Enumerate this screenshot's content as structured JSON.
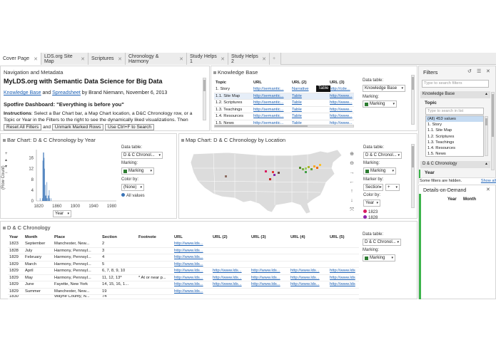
{
  "tabs": [
    {
      "label": "Cover Page",
      "active": true,
      "close": "✕"
    },
    {
      "label": "LDS.org Site Map",
      "close": "✕"
    },
    {
      "label": "Scriptures",
      "close": "✕"
    },
    {
      "label": "Chronology & Harmony",
      "close": "✕"
    },
    {
      "label": "Study Helps 1",
      "close": "✕"
    },
    {
      "label": "Study Helps 2",
      "close": "✕"
    }
  ],
  "add_tab": "+",
  "nav": {
    "title": "Navigation and Metadata",
    "heading": "MyLDS.org with Semantic Data Science for Big Data",
    "link1": "Knowledge Base",
    "and": "and",
    "link2": "Spreadsheet",
    "byline": "by Brand Niemann, November 6, 2013",
    "dashboard": "Spotfire Dashboard: \"Everything is before you\"",
    "instr_label": "Instructions",
    "instr_text1": ": Select a Bar Chart bar, a Map Chart location, a D&C Chronology row, or a",
    "instr_text2": "Topic or Year in the Filters to the right to see the dynamically liked visualizations. Then",
    "btn_reset": "Reset All Filters",
    "btn_and": "and",
    "btn_unmark": "Unmark Marked Rows",
    "btn_ctrl": "Use Ctrl+F to Search"
  },
  "kb": {
    "title": "Knowledge Base",
    "columns": [
      "Topic",
      "URL",
      "URL (2)",
      "URL (3)"
    ],
    "rows": [
      [
        "1. Story",
        "http://semantic...",
        "Narrative",
        "http://cde..."
      ],
      [
        "1.1. Site Map",
        "http://semantic...",
        "Table",
        "http://www..."
      ],
      [
        "1.2. Scriptures",
        "http://semantic...",
        "Table",
        "http://www..."
      ],
      [
        "1.3. Teachings",
        "http://semantic...",
        "Table",
        "http://www..."
      ],
      [
        "1.4. Resources",
        "http://semantic...",
        "Table",
        "http://www..."
      ],
      [
        "1.5. News",
        "http://semantic...",
        "Table",
        "http://www..."
      ]
    ],
    "tooltip": "Table",
    "data_table_label": "Data table:",
    "data_table_value": "Knowledge Base",
    "marking_label": "Marking:",
    "marking_value": "Marking"
  },
  "bar": {
    "title": "Bar Chart: D & C Chronology by Year",
    "ylabel": "(Row Count)",
    "x_select": "Year",
    "data_table_label": "Data table:",
    "data_table_value": "D & C Chronol...",
    "marking_label": "Marking:",
    "marking_value": "Marking",
    "color_label": "Color by:",
    "color_value": "(None)",
    "legend": "All values"
  },
  "chart_data": {
    "type": "bar",
    "x": [
      1823,
      1828,
      1829,
      1830,
      1831,
      1832,
      1833,
      1834,
      1835,
      1836,
      1837,
      1838,
      1839,
      1841,
      1842,
      1843,
      1844,
      1847
    ],
    "values": [
      1,
      1,
      15,
      19,
      37,
      16,
      12,
      6,
      2,
      2,
      1,
      7,
      1,
      2,
      2,
      4,
      1,
      1
    ],
    "xlim": [
      1815,
      1990
    ],
    "ylim": [
      0,
      18
    ],
    "yticks": [
      "16",
      "12",
      "8",
      "4",
      "0"
    ],
    "xticks": [
      "1820",
      "1860",
      "1900",
      "1940",
      "1980"
    ],
    "color": "#3a74b7"
  },
  "map": {
    "title": "Map Chart: D & C Chronology by Location",
    "data_table_label": "Data table:",
    "data_table_value": "D & C Chronol...",
    "marking_label": "Marking:",
    "marking_value": "Marking",
    "marker_label": "Marker by:",
    "marker_value": "Section",
    "marker_plus": "+",
    "color_label": "Color by:",
    "color_value": "Year",
    "legend": [
      "1823",
      "1828"
    ]
  },
  "chronology": {
    "title": "D & C Chronology",
    "columns": [
      "Year",
      "Month",
      "Place",
      "Section",
      "Footnote",
      "URL",
      "URL (2)",
      "URL (3)",
      "URL (4)",
      "URL (5)"
    ],
    "rows": [
      [
        "1823",
        "September",
        "Manchester, New...",
        "2",
        "",
        "http://www.lds...",
        "",
        "",
        "",
        ""
      ],
      [
        "1828",
        "July",
        "Harmony, Pennsyl...",
        "3",
        "",
        "http://www.lds...",
        "",
        "",
        "",
        ""
      ],
      [
        "1829",
        "February",
        "Harmony, Pennsyl...",
        "4",
        "",
        "http://www.lds...",
        "",
        "",
        "",
        ""
      ],
      [
        "1829",
        "March",
        "Harmony, Pennsyl...",
        "5",
        "",
        "http://www.lds...",
        "",
        "",
        "",
        ""
      ],
      [
        "1829",
        "April",
        "Harmony, Pennsyl...",
        "6, 7, 8, 9, 10",
        "",
        "http://www.lds...",
        "http://www.lds...",
        "http://www.lds...",
        "http://www.lds...",
        "http://www.lds"
      ],
      [
        "1829",
        "May",
        "Harmony, Pennsyl...",
        "11, 12, 13*",
        "* At or near p...",
        "http://www.lds...",
        "http://www.lds...",
        "http://www.lds...",
        "http://www.lds...",
        "http://www.lds"
      ],
      [
        "1829",
        "June",
        "Fayette, New York",
        "14, 15, 16, 1...",
        "",
        "http://www.lds...",
        "http://www.lds...",
        "http://www.lds...",
        "http://www.lds...",
        "http://www.lds"
      ],
      [
        "1829",
        "Summer",
        "Manchester, New...",
        "19",
        "",
        "http://www.lds...",
        "",
        "",
        "",
        ""
      ],
      [
        "1830",
        "",
        "Wayne County, N...",
        "74",
        "",
        "",
        "",
        "",
        "",
        ""
      ]
    ],
    "data_table_label": "Data table:",
    "data_table_value": "D & C Chronol...",
    "marking_label": "Marking:",
    "marking_value": "Marking"
  },
  "filters": {
    "title": "Filters",
    "search_placeholder": "Type to search filters",
    "group1": "Knowledge Base",
    "field_label": "Topic",
    "list_placeholder": "Type to search in list",
    "list_items": [
      "(All) 453 values",
      "1. Story",
      "1.1. Site Map",
      "1.2. Scriptures",
      "1.3. Teachings",
      "1.4. Resources",
      "1.5. News"
    ],
    "group2": "D & C Chronology",
    "field2": "Year",
    "hidden_text": "Some filters are hidden.",
    "show_all": "Show all"
  },
  "details": {
    "title": "Details-on-Demand",
    "col1": "Year",
    "col2": "Month"
  }
}
